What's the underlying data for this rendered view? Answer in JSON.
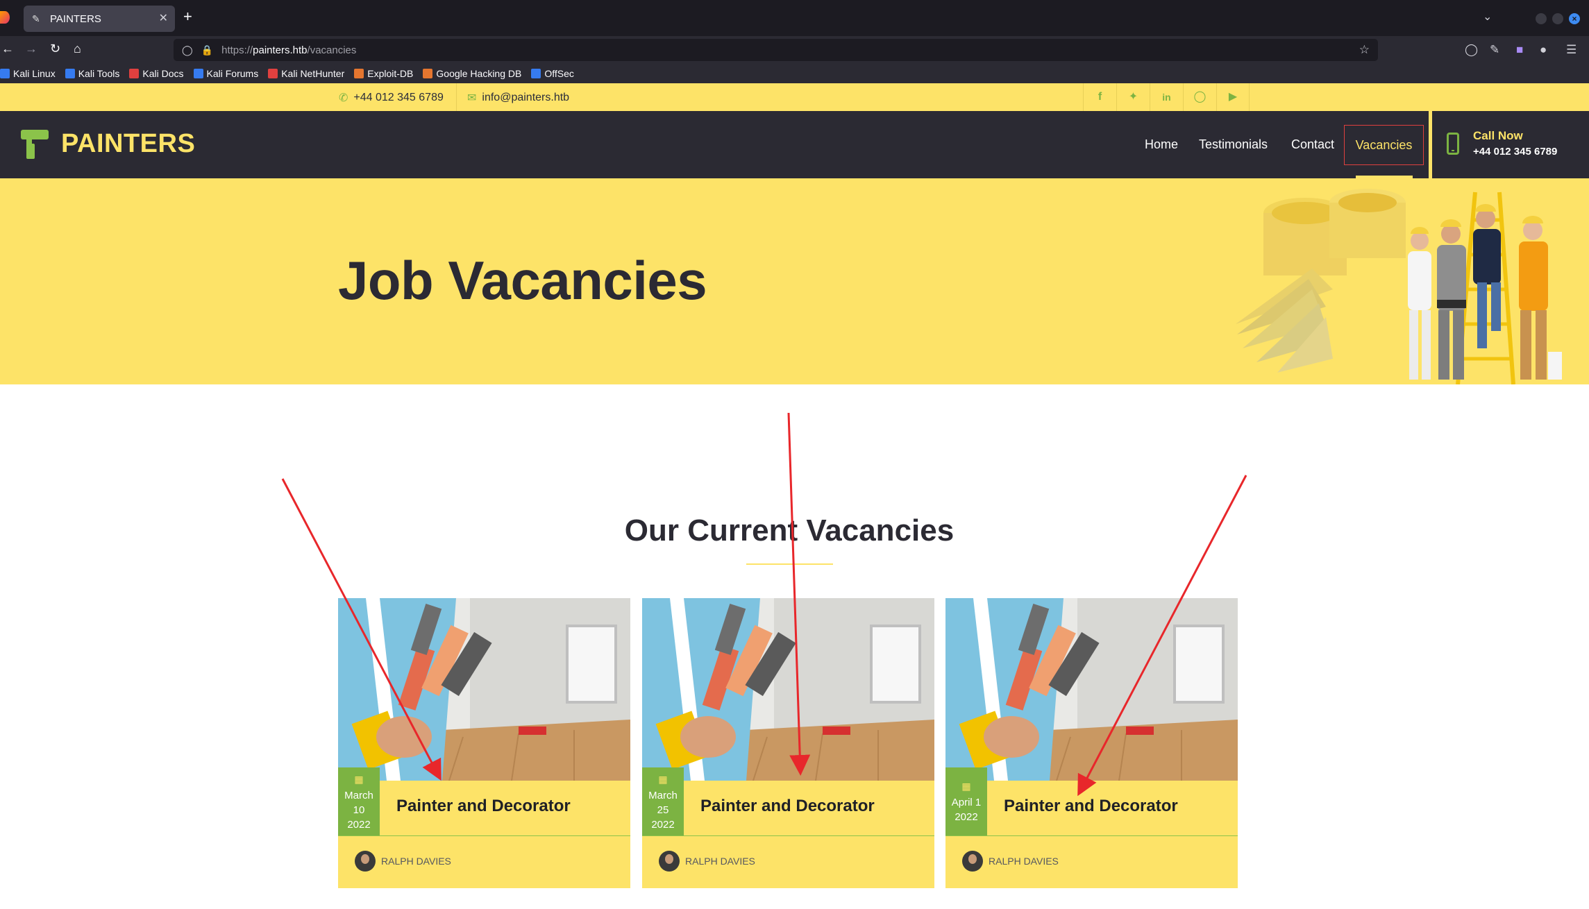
{
  "browser": {
    "tab_title": "PAINTERS",
    "url_prefix": "https://",
    "url_host": "painters.htb",
    "url_path": "/vacancies",
    "extension_badge": "16",
    "bookmarks": [
      {
        "label": "Kali Linux",
        "color": "#367bf0"
      },
      {
        "label": "Kali Tools",
        "color": "#367bf0"
      },
      {
        "label": "Kali Docs",
        "color": "#e0403f"
      },
      {
        "label": "Kali Forums",
        "color": "#367bf0"
      },
      {
        "label": "Kali NetHunter",
        "color": "#e0403f"
      },
      {
        "label": "Exploit-DB",
        "color": "#e5762f"
      },
      {
        "label": "Google Hacking DB",
        "color": "#e5762f"
      },
      {
        "label": "OffSec",
        "color": "#367bf0"
      }
    ]
  },
  "site": {
    "topbar": {
      "phone": "+44 012 345 6789",
      "email": "info@painters.htb",
      "social": [
        "f",
        "t",
        "in",
        "ig",
        "yt"
      ]
    },
    "brand": "PAINTERS",
    "nav": {
      "home": "Home",
      "testimonials": "Testimonials",
      "contact": "Contact",
      "vacancies": "Vacancies"
    },
    "call": {
      "label": "Call Now",
      "number": "+44 012 345 6789"
    },
    "hero_title": "Job Vacancies",
    "section_title": "Our Current Vacancies",
    "vacancies": [
      {
        "date_line1": "March",
        "date_line2": "10",
        "date_line3": "2022",
        "title": "Painter and Decorator",
        "author": "RALPH DAVIES"
      },
      {
        "date_line1": "March",
        "date_line2": "25",
        "date_line3": "2022",
        "title": "Painter and Decorator",
        "author": "RALPH DAVIES"
      },
      {
        "date_line1": "April 1",
        "date_line2": "2022",
        "date_line3": "",
        "title": "Painter and Decorator",
        "author": "RALPH DAVIES"
      }
    ]
  },
  "colors": {
    "brand_yellow": "#fde368",
    "brand_green": "#7cb342",
    "header_dark": "#2b2a33",
    "annotation_red": "#e8272b"
  }
}
